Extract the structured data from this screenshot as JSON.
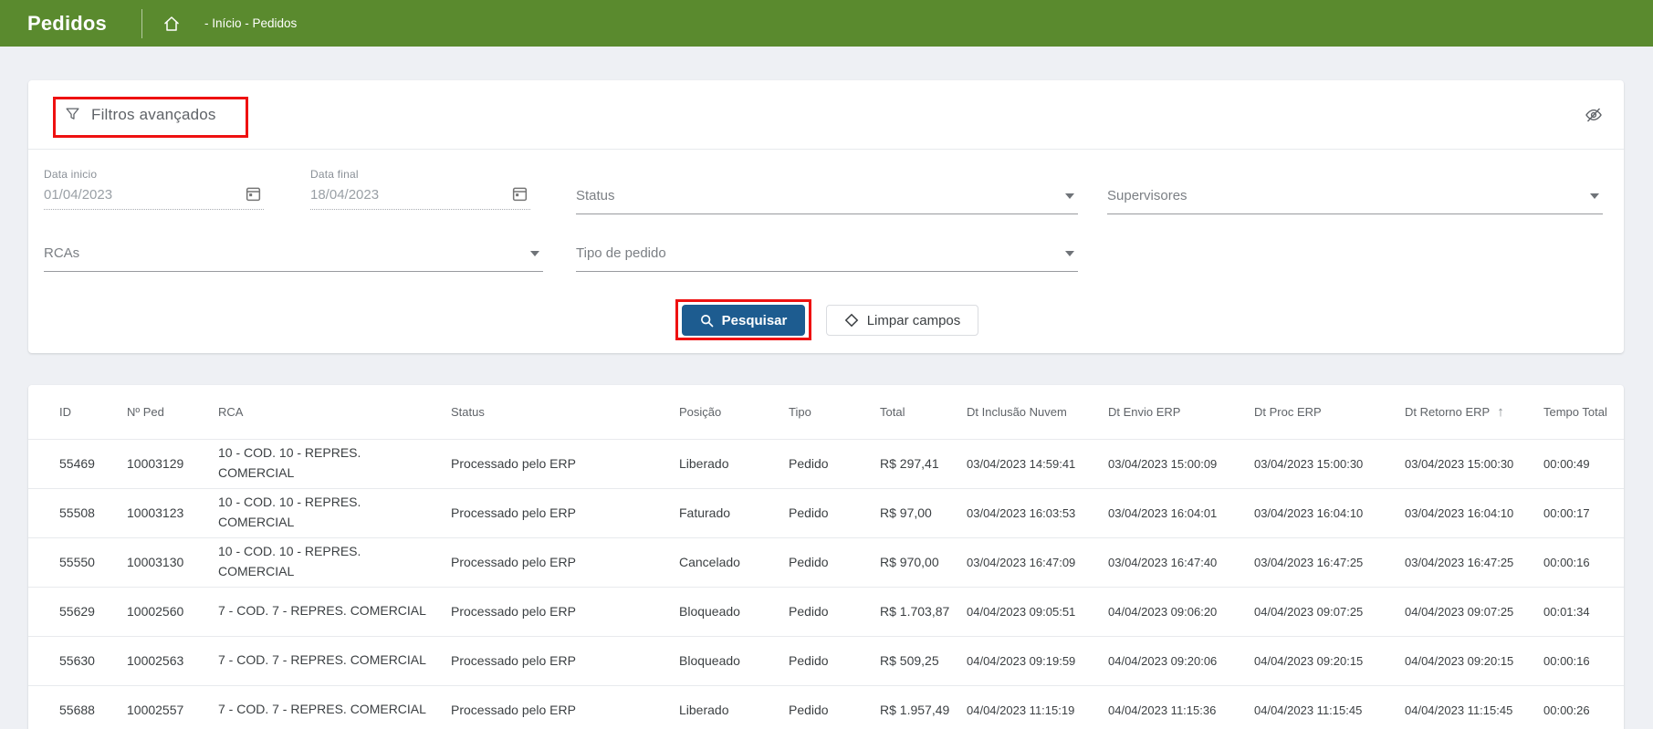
{
  "colors": {
    "header_bg": "#5a8a2e",
    "primary_button_bg": "#1d5c90",
    "annotation_red": "#ee1111",
    "page_bg": "#eef0f4"
  },
  "header": {
    "title": "Pedidos",
    "breadcrumb": "- Início - Pedidos"
  },
  "filters": {
    "title": "Filtros avançados",
    "data_inicio": {
      "label": "Data inicio",
      "value": "01/04/2023"
    },
    "data_final": {
      "label": "Data final",
      "value": "18/04/2023"
    },
    "status_label": "Status",
    "supervisores_label": "Supervisores",
    "rcas_label": "RCAs",
    "tipo_pedido_label": "Tipo de pedido",
    "search_button": "Pesquisar",
    "clear_button": "Limpar campos"
  },
  "table": {
    "columns": [
      {
        "key": "id",
        "label": "ID"
      },
      {
        "key": "n_ped",
        "label": "Nº Ped"
      },
      {
        "key": "rca",
        "label": "RCA"
      },
      {
        "key": "status",
        "label": "Status"
      },
      {
        "key": "posicao",
        "label": "Posição"
      },
      {
        "key": "tipo",
        "label": "Tipo"
      },
      {
        "key": "total",
        "label": "Total"
      },
      {
        "key": "dt_inclusao_nuvem",
        "label": "Dt Inclusão Nuvem"
      },
      {
        "key": "dt_envio_erp",
        "label": "Dt Envio ERP"
      },
      {
        "key": "dt_proc_erp",
        "label": "Dt Proc ERP"
      },
      {
        "key": "dt_retorno_erp",
        "label": "Dt Retorno ERP",
        "sorted": "asc"
      },
      {
        "key": "tempo_total",
        "label": "Tempo Total"
      }
    ],
    "sort_icon": "↑",
    "rows": [
      {
        "id": "55469",
        "n_ped": "10003129",
        "rca": "10 - COD. 10 - REPRES. COMERCIAL",
        "status": "Processado pelo ERP",
        "posicao": "Liberado",
        "tipo": "Pedido",
        "total": "R$ 297,41",
        "dt_inclusao_nuvem": "03/04/2023 14:59:41",
        "dt_envio_erp": "03/04/2023 15:00:09",
        "dt_proc_erp": "03/04/2023 15:00:30",
        "dt_retorno_erp": "03/04/2023 15:00:30",
        "tempo_total": "00:00:49"
      },
      {
        "id": "55508",
        "n_ped": "10003123",
        "rca": "10 - COD. 10 - REPRES. COMERCIAL",
        "status": "Processado pelo ERP",
        "posicao": "Faturado",
        "tipo": "Pedido",
        "total": "R$ 97,00",
        "dt_inclusao_nuvem": "03/04/2023 16:03:53",
        "dt_envio_erp": "03/04/2023 16:04:01",
        "dt_proc_erp": "03/04/2023 16:04:10",
        "dt_retorno_erp": "03/04/2023 16:04:10",
        "tempo_total": "00:00:17"
      },
      {
        "id": "55550",
        "n_ped": "10003130",
        "rca": "10 - COD. 10 - REPRES. COMERCIAL",
        "status": "Processado pelo ERP",
        "posicao": "Cancelado",
        "tipo": "Pedido",
        "total": "R$ 970,00",
        "dt_inclusao_nuvem": "03/04/2023 16:47:09",
        "dt_envio_erp": "03/04/2023 16:47:40",
        "dt_proc_erp": "03/04/2023 16:47:25",
        "dt_retorno_erp": "03/04/2023 16:47:25",
        "tempo_total": "00:00:16"
      },
      {
        "id": "55629",
        "n_ped": "10002560",
        "rca": "7 - COD. 7 - REPRES. COMERCIAL",
        "status": "Processado pelo ERP",
        "posicao": "Bloqueado",
        "tipo": "Pedido",
        "total": "R$ 1.703,87",
        "dt_inclusao_nuvem": "04/04/2023 09:05:51",
        "dt_envio_erp": "04/04/2023 09:06:20",
        "dt_proc_erp": "04/04/2023 09:07:25",
        "dt_retorno_erp": "04/04/2023 09:07:25",
        "tempo_total": "00:01:34"
      },
      {
        "id": "55630",
        "n_ped": "10002563",
        "rca": "7 - COD. 7 - REPRES. COMERCIAL",
        "status": "Processado pelo ERP",
        "posicao": "Bloqueado",
        "tipo": "Pedido",
        "total": "R$ 509,25",
        "dt_inclusao_nuvem": "04/04/2023 09:19:59",
        "dt_envio_erp": "04/04/2023 09:20:06",
        "dt_proc_erp": "04/04/2023 09:20:15",
        "dt_retorno_erp": "04/04/2023 09:20:15",
        "tempo_total": "00:00:16"
      },
      {
        "id": "55688",
        "n_ped": "10002557",
        "rca": "7 - COD. 7 - REPRES. COMERCIAL",
        "status": "Processado pelo ERP",
        "posicao": "Liberado",
        "tipo": "Pedido",
        "total": "R$ 1.957,49",
        "dt_inclusao_nuvem": "04/04/2023 11:15:19",
        "dt_envio_erp": "04/04/2023 11:15:36",
        "dt_proc_erp": "04/04/2023 11:15:45",
        "dt_retorno_erp": "04/04/2023 11:15:45",
        "tempo_total": "00:00:26"
      }
    ]
  }
}
